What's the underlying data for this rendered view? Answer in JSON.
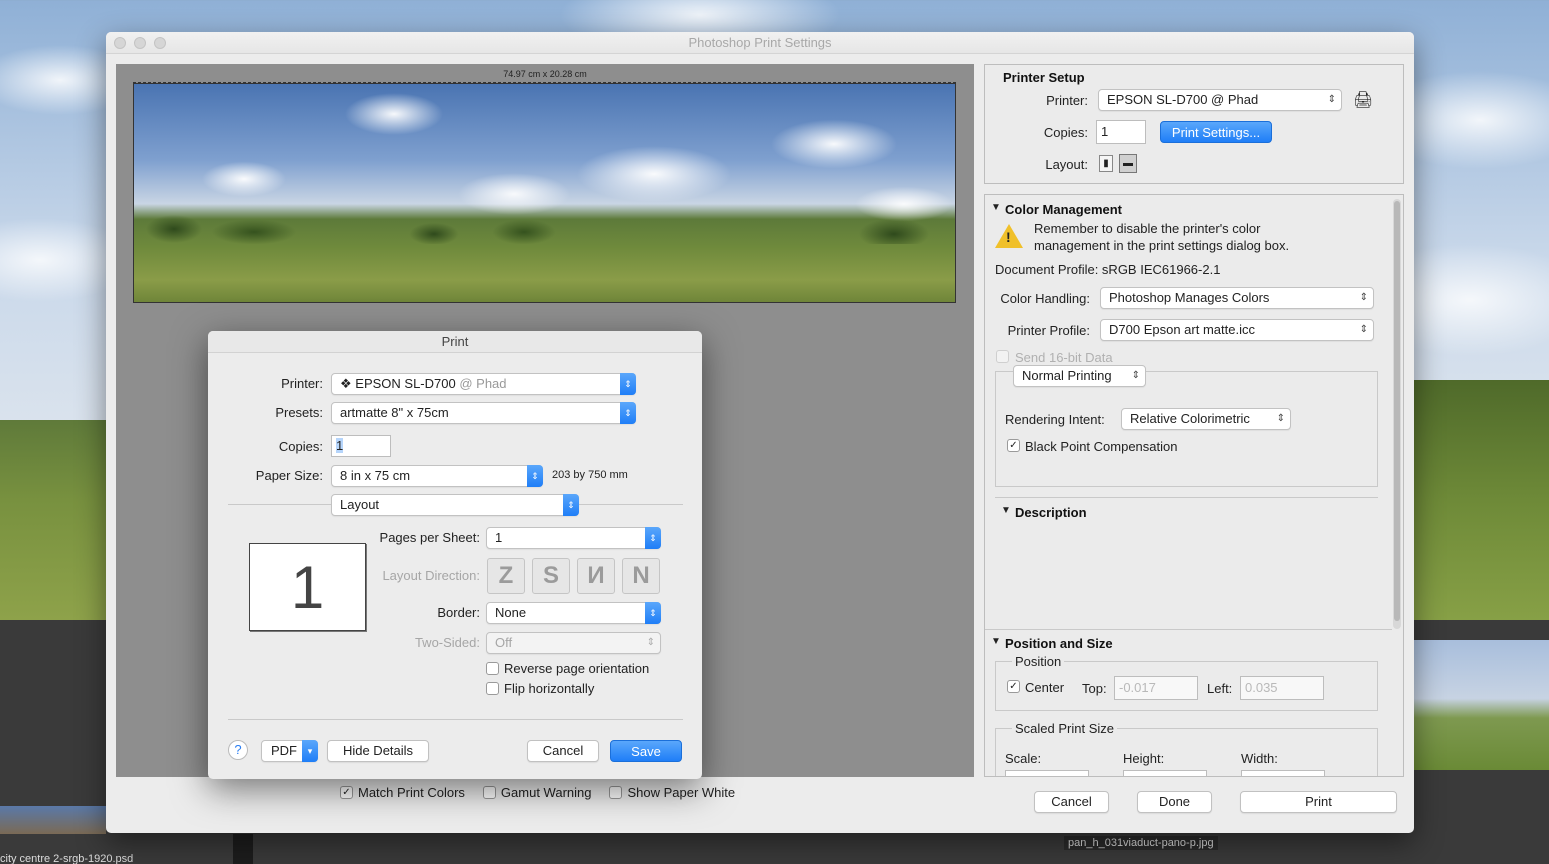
{
  "background": {
    "left_filename": "city centre 2-srgb-1920.psd",
    "right_filename": "pan_h_031viaduct-pano-p.jpg"
  },
  "window": {
    "title": "Photoshop Print Settings"
  },
  "preview": {
    "dimensions": "74.97 cm x 20.28 cm"
  },
  "bottom_options": {
    "match_print_colors": "Match Print Colors",
    "gamut_warning": "Gamut Warning",
    "show_paper_white": "Show Paper White"
  },
  "printer_setup": {
    "title": "Printer Setup",
    "printer_label": "Printer:",
    "printer_value": "EPSON SL-D700 @ Phad",
    "copies_label": "Copies:",
    "copies_value": "1",
    "print_settings_button": "Print Settings...",
    "layout_label": "Layout:"
  },
  "color_management": {
    "title": "Color Management",
    "warning_text": "Remember to disable the printer's color management in the print settings dialog box.",
    "document_profile": "Document Profile: sRGB IEC61966-2.1",
    "color_handling_label": "Color Handling:",
    "color_handling_value": "Photoshop Manages Colors",
    "printer_profile_label": "Printer Profile:",
    "printer_profile_value": "D700 Epson art matte.icc",
    "send_16bit": "Send 16-bit Data",
    "printing_mode": "Normal Printing",
    "rendering_intent_label": "Rendering Intent:",
    "rendering_intent_value": "Relative Colorimetric",
    "black_point": "Black Point Compensation"
  },
  "description": {
    "title": "Description"
  },
  "position_size": {
    "title": "Position and Size",
    "position_label": "Position",
    "center_label": "Center",
    "top_label": "Top:",
    "top_value": "-0.017",
    "left_label": "Left:",
    "left_value": "0.035",
    "scaled_label": "Scaled Print Size",
    "scale_label": "Scale:",
    "height_label": "Height:",
    "width_label": "Width:"
  },
  "footer_buttons": {
    "cancel": "Cancel",
    "done": "Done",
    "print": "Print"
  },
  "print_dialog": {
    "title": "Print",
    "printer_label": "Printer:",
    "printer_name": "EPSON SL-D700",
    "printer_host": "@ Phad",
    "presets_label": "Presets:",
    "presets_value": "artmatte 8\" x 75cm",
    "copies_label": "Copies:",
    "copies_value": "1",
    "paper_size_label": "Paper Size:",
    "paper_size_value": "8 in x  75 cm",
    "paper_size_mm": "203 by 750 mm",
    "section_value": "Layout",
    "thumb_number": "1",
    "pages_per_sheet_label": "Pages per Sheet:",
    "pages_per_sheet_value": "1",
    "layout_direction_label": "Layout Direction:",
    "border_label": "Border:",
    "border_value": "None",
    "two_sided_label": "Two-Sided:",
    "two_sided_value": "Off",
    "reverse_orientation": "Reverse page orientation",
    "flip_horizontally": "Flip horizontally",
    "help": "?",
    "pdf": "PDF",
    "hide_details": "Hide Details",
    "cancel": "Cancel",
    "save": "Save"
  }
}
